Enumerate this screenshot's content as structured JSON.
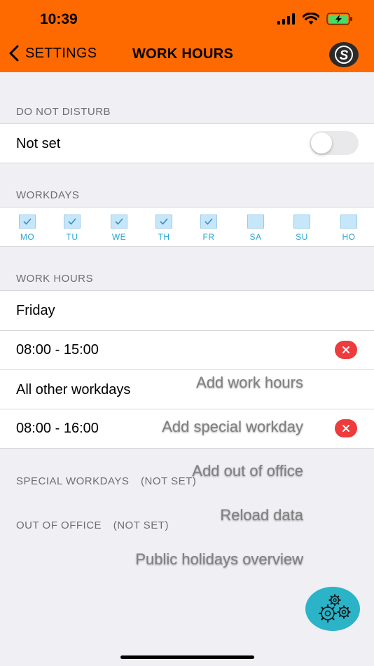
{
  "status_bar": {
    "time": "10:39"
  },
  "nav": {
    "back_label": "SETTINGS",
    "title": "WORK HOURS",
    "logo_letter": "S"
  },
  "dnd": {
    "header": "DO NOT DISTURB",
    "value": "Not set",
    "toggle_on": false
  },
  "workdays": {
    "header": "WORKDAYS",
    "days": [
      {
        "label": "MO",
        "checked": true
      },
      {
        "label": "TU",
        "checked": true
      },
      {
        "label": "WE",
        "checked": true
      },
      {
        "label": "TH",
        "checked": true
      },
      {
        "label": "FR",
        "checked": true
      },
      {
        "label": "SA",
        "checked": false
      },
      {
        "label": "SU",
        "checked": false
      },
      {
        "label": "HO",
        "checked": false
      }
    ]
  },
  "work_hours": {
    "header": "WORK HOURS",
    "groups": [
      {
        "label": "Friday",
        "hours": "08:00 - 15:00"
      },
      {
        "label": "All other workdays",
        "hours": "08:00 - 16:00"
      }
    ]
  },
  "special_workdays": {
    "header": "SPECIAL WORKDAYS",
    "status": "(NOT SET)"
  },
  "out_of_office": {
    "header": "OUT OF OFFICE",
    "status": "(NOT SET)"
  },
  "fab_menu": {
    "items": [
      "Add work hours",
      "Add special workday",
      "Add out of office",
      "Reload data",
      "Public holidays overview"
    ]
  },
  "colors": {
    "accent": "#ff6a00",
    "fab": "#2bb3c8",
    "delete": "#ee3b3b",
    "day_label": "#2aa7d6"
  }
}
